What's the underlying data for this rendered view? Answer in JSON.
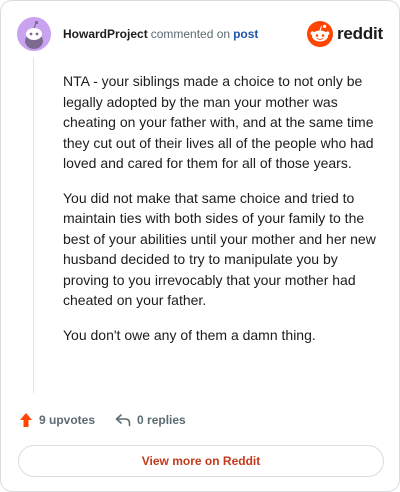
{
  "header": {
    "username": "HowardProject",
    "action": "commented on",
    "post_link": "post",
    "logo_text": "reddit",
    "logo_icon": "reddit-snoo-icon",
    "avatar_icon": "snoo-avatar-icon"
  },
  "comment": {
    "paragraphs": [
      "NTA - your siblings made a choice to not only be legally adopted by the man your mother was cheating on your father with, and at the same time they cut out of their lives all of the people who had loved and cared for them for all of those years.",
      "You did not make that same choice and tried to maintain ties with both sides of your family to the best of your abilities until your mother and her new husband decided to try to manipulate you by proving to you irrevocably that your mother had cheated on your father.",
      "You don't owe any of them a damn thing."
    ]
  },
  "actions": {
    "upvotes": "9 upvotes",
    "replies": "0 replies",
    "upvote_icon": "upvote-arrow-icon",
    "reply_icon": "reply-arrow-icon"
  },
  "footer": {
    "view_more": "View more on Reddit"
  },
  "colors": {
    "brand": "#ff4500",
    "link": "#1d56a8",
    "view_more": "#c3391b",
    "avatar_bg": "#c9a3f0"
  }
}
